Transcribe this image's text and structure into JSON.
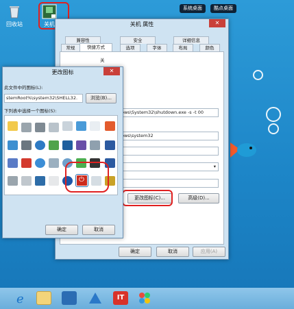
{
  "desktop": {
    "icons": [
      {
        "label": "回收站",
        "icon": "recycle-bin-icon"
      },
      {
        "label": "关机",
        "icon": "shutdown-shortcut-icon"
      }
    ],
    "topbar": {
      "desktop_btn": "系统桌面",
      "kuke_btn": "酷点桌面"
    }
  },
  "properties_dialog": {
    "title": "关机 属性",
    "tabs_row1": [
      "兼容性",
      "安全",
      "详细信息"
    ],
    "tabs_row2": [
      "常规",
      "快捷方式",
      "选项",
      "字体",
      "布局",
      "颜色"
    ],
    "name": "关",
    "fragment": "2",
    "target": "ows\\System32\\shutdown.exe -s -t 00",
    "start_in": "ows\\system32",
    "change_icon_button": "更改图标(C)...",
    "advanced_button": "高级(D)...",
    "ok": "确定",
    "cancel": "取消",
    "apply": "应用(A)"
  },
  "change_icon_dialog": {
    "title": "更改图标",
    "file_label": "此文件中的图标(L):",
    "file_path": "stemRoot%\\system32\\SHELL32.",
    "browse": "浏览(B)...",
    "list_label": "下列表中选择一个图标(S):",
    "ok": "确定",
    "cancel": "取消"
  },
  "colors": {
    "accent_red": "#e02020",
    "close_red": "#c9403a",
    "selected_icon": "#cc2b1d"
  },
  "taskbar": {
    "icons": [
      "internet-explorer-icon",
      "file-explorer-icon",
      "store-icon",
      "app-icon",
      "it-app-icon",
      "puzzle-app-icon"
    ]
  }
}
